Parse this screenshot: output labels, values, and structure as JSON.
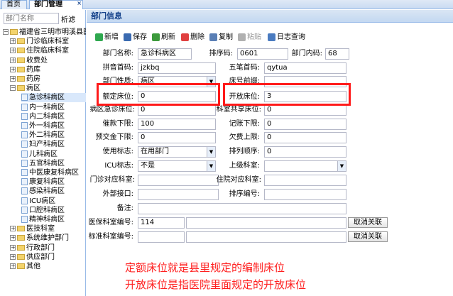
{
  "tabs": [
    {
      "label": "首页"
    },
    {
      "label": "部门管理"
    }
  ],
  "tab_close": "×",
  "left": {
    "search_placeholder": "部门名称",
    "filter_label": "析滤",
    "tree": [
      {
        "label": "福建省三明市明溪县医",
        "level": 0,
        "exp": "−",
        "kind": "folder"
      },
      {
        "label": "门诊临床科室",
        "level": 1,
        "exp": "+",
        "kind": "folder"
      },
      {
        "label": "住院临床科室",
        "level": 1,
        "exp": "+",
        "kind": "folder"
      },
      {
        "label": "收费处",
        "level": 1,
        "exp": "+",
        "kind": "folder"
      },
      {
        "label": "药库",
        "level": 1,
        "exp": "+",
        "kind": "folder"
      },
      {
        "label": "药房",
        "level": 1,
        "exp": "+",
        "kind": "folder"
      },
      {
        "label": "病区",
        "level": 1,
        "exp": "−",
        "kind": "folder"
      },
      {
        "label": "急诊科病区",
        "level": 2,
        "kind": "leaf",
        "selected": true
      },
      {
        "label": "内一科病区",
        "level": 2,
        "kind": "leaf"
      },
      {
        "label": "内二科病区",
        "level": 2,
        "kind": "leaf"
      },
      {
        "label": "外一科病区",
        "level": 2,
        "kind": "leaf"
      },
      {
        "label": "外二科病区",
        "level": 2,
        "kind": "leaf"
      },
      {
        "label": "妇产科病区",
        "level": 2,
        "kind": "leaf"
      },
      {
        "label": "儿科病区",
        "level": 2,
        "kind": "leaf"
      },
      {
        "label": "五官科病区",
        "level": 2,
        "kind": "leaf"
      },
      {
        "label": "中医康复科病区",
        "level": 2,
        "kind": "leaf"
      },
      {
        "label": "康复科病区",
        "level": 2,
        "kind": "leaf"
      },
      {
        "label": "感染科病区",
        "level": 2,
        "kind": "leaf"
      },
      {
        "label": "ICU病区",
        "level": 2,
        "kind": "leaf"
      },
      {
        "label": "口腔科病区",
        "level": 2,
        "kind": "leaf"
      },
      {
        "label": "精神科病区",
        "level": 2,
        "kind": "leaf"
      },
      {
        "label": "医技科室",
        "level": 1,
        "exp": "+",
        "kind": "folder"
      },
      {
        "label": "系统维护部门",
        "level": 1,
        "exp": "+",
        "kind": "folder"
      },
      {
        "label": "行政部门",
        "level": 1,
        "exp": "+",
        "kind": "folder"
      },
      {
        "label": "供应部门",
        "level": 1,
        "exp": "+",
        "kind": "folder"
      },
      {
        "label": "其他",
        "level": 1,
        "exp": "+",
        "kind": "folder"
      }
    ]
  },
  "panel_title": "部门信息",
  "toolbar": [
    {
      "label": "新增",
      "icon": "add-icon",
      "color": "#2fa84f"
    },
    {
      "label": "保存",
      "icon": "save-icon",
      "color": "#3a6ab0"
    },
    {
      "label": "刷新",
      "icon": "refresh-icon",
      "color": "#3c9a3c"
    },
    {
      "label": "删除",
      "icon": "delete-icon",
      "color": "#e04040"
    },
    {
      "label": "复制",
      "icon": "copy-icon",
      "color": "#5a7fb5"
    },
    {
      "label": "粘贴",
      "icon": "paste-icon",
      "color": "#b0b0b0",
      "disabled": true
    },
    {
      "label": "日志查询",
      "icon": "log-search-icon",
      "color": "#4a7bc0"
    }
  ],
  "form": {
    "dept_name_label": "部门名称:",
    "dept_name": "急诊科病区",
    "sort_no_label": "排序码:",
    "sort_no": "0601",
    "dept_code_label": "部门内码:",
    "dept_code": "68",
    "pinyin_label": "拼音首码:",
    "pinyin": "jzkbq",
    "wubi_label": "五笔首码:",
    "wubi": "qytua",
    "dept_type_label": "部门性质:",
    "dept_type": "病区",
    "bed_prefix_label": "床号前缀:",
    "bed_prefix": "",
    "quota_bed_label": "额定床位:",
    "quota_bed": "0",
    "open_bed_label": "开放床位:",
    "open_bed": "3",
    "emerg_bed_label": "病区急诊床位:",
    "emerg_bed": "0",
    "shared_dept_label": "科室共享床位:",
    "shared_dept": "0",
    "overdraft_label": "催款下限:",
    "overdraft": "100",
    "account_limit_label": "记账下限:",
    "account_limit": "0",
    "prepay_label": "预交金下限:",
    "prepay": "0",
    "arrears_label": "欠费上限:",
    "arrears": "0",
    "status_label": "使用标志:",
    "status": "在用部门",
    "sort_order_label": "排列顺序:",
    "sort_order": "0",
    "icu_label": "ICU标志:",
    "icu": "不是",
    "superior_label": "上级科室:",
    "superior": "",
    "outpatient_label": "门诊对应科室:",
    "outpatient": "",
    "inpatient_label": "住院对应科室:",
    "inpatient": "",
    "ext_label": "外部接口:",
    "ext": "",
    "sort_code_label": "排序编号:",
    "sort_code": "",
    "remark_label": "备注:",
    "remark": "",
    "insurance_label": "医保科室编号:",
    "insurance": "114",
    "standard_label": "标准科室编号:",
    "standard": "",
    "unlink_label": "取消关联"
  },
  "annotation": {
    "line1": "定额床位就是县里规定的编制床位",
    "line2": "开放床位是指医院里面规定的开放床位",
    "color": "#ff2020"
  }
}
